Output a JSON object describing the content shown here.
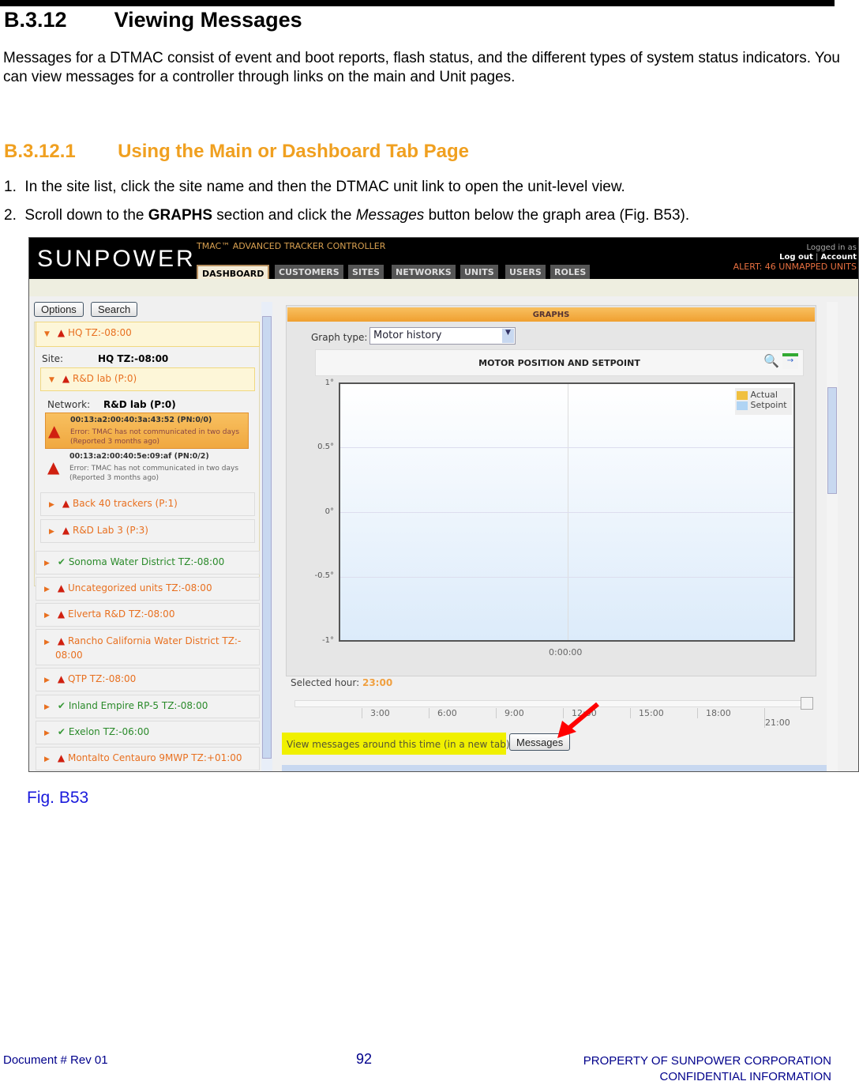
{
  "heading": {
    "number": "B.3.12",
    "title": "Viewing Messages"
  },
  "intro": "Messages for a DTMAC consist of event and boot reports, flash status, and the different types of system status indicators. You can view messages for a controller through links on the main and Unit pages.",
  "subheading": {
    "number": "B.3.12.1",
    "title": "Using the Main or Dashboard Tab Page"
  },
  "steps": [
    {
      "num": "1.",
      "text": "In the site list, click the site name and then the DTMAC unit link to open the unit-level view."
    },
    {
      "num": "2.",
      "pre": "Scroll down to the ",
      "bold": "GRAPHS",
      "mid": " section and click the ",
      "italic": "Messages",
      "post": " button below the graph area (Fig. B53)."
    }
  ],
  "screenshot": {
    "logo": "SUNPOWER",
    "app_title": "TMAC™ ADVANCED TRACKER CONTROLLER",
    "tabs": [
      "DASHBOARD",
      "CUSTOMERS",
      "SITES",
      "NETWORKS",
      "UNITS",
      "USERS",
      "ROLES"
    ],
    "active_tab": "DASHBOARD",
    "logged_in": "Logged in as",
    "logout": "Log out",
    "account": "Account",
    "sep": "|",
    "alert": "ALERT: 46 UNMAPPED UNITS",
    "sidebar": {
      "options": "Options",
      "search": "Search",
      "site_header": "HQ TZ:-08:00",
      "site_label": "Site:",
      "site_value": "HQ TZ:-08:00",
      "network_header": "R&D lab (P:0)",
      "network_label": "Network:",
      "network_value": "R&D lab (P:0)",
      "units": [
        {
          "id": "00:13:a2:00:40:3a:43:52 (PN:0/0)",
          "msg": "Error: TMAC has not communicated in two days (Reported 3 months ago)"
        },
        {
          "id": "00:13:a2:00:40:5e:09:af (PN:0/2)",
          "msg": "Error: TMAC has not communicated in two days (Reported 3 months ago)"
        }
      ],
      "networks": [
        "Back 40 trackers (P:1)",
        "R&D Lab 3 (P:3)"
      ],
      "sites": [
        {
          "name": "Sonoma Water District TZ:-08:00",
          "status": "ok"
        },
        {
          "name": "Uncategorized units TZ:-08:00",
          "status": "warn"
        },
        {
          "name": "Elverta R&D TZ:-08:00",
          "status": "warn"
        },
        {
          "name": "Rancho California Water District TZ:-",
          "name2": "08:00",
          "status": "warn"
        },
        {
          "name": "QTP TZ:-08:00",
          "status": "warn"
        },
        {
          "name": "Inland Empire RP-5 TZ:-08:00",
          "status": "ok"
        },
        {
          "name": "Exelon TZ:-06:00",
          "status": "ok"
        },
        {
          "name": "Montalto Centauro 9MWP TZ:+01:00",
          "status": "warn"
        }
      ]
    },
    "graphs": {
      "header": "GRAPHS",
      "graph_type_label": "Graph type:",
      "graph_type_value": "Motor history",
      "chart_title": "MOTOR POSITION AND SETPOINT",
      "y_ticks": [
        "1°",
        "0.5°",
        "0°",
        "-0.5°",
        "-1°"
      ],
      "x_label": "0:00:00",
      "legend": [
        {
          "name": "Actual",
          "color": "#f0c040"
        },
        {
          "name": "Setpoint",
          "color": "#b0d4f4"
        }
      ],
      "selected_hour_label": "Selected hour:",
      "selected_hour": "23:00",
      "slider_ticks": [
        "3:00",
        "6:00",
        "9:00",
        "12:00",
        "15:00",
        "18:00",
        "21:00"
      ],
      "slider_value_hour": 23,
      "messages_prompt": "View messages around this time (in a new tab):",
      "messages_button": "Messages"
    }
  },
  "caption": "Fig. B53",
  "footer": {
    "doc": "Document #  Rev 01",
    "page": "92",
    "property": "PROPERTY OF SUNPOWER CORPORATION",
    "confidential": "CONFIDENTIAL INFORMATION"
  }
}
